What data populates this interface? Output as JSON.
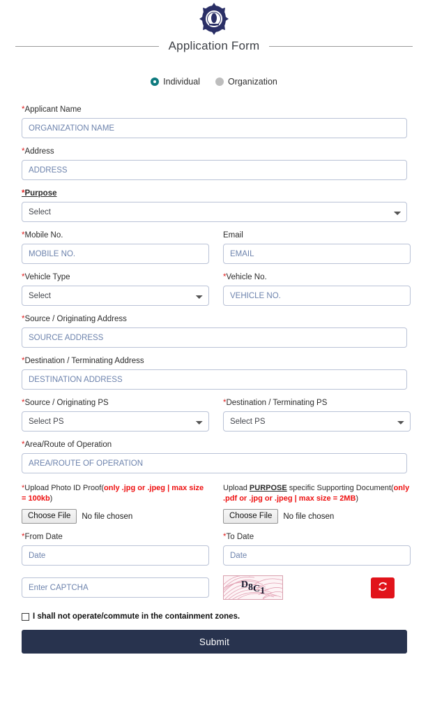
{
  "header": {
    "logo_icon": "police-emblem-icon",
    "title": "Application Form"
  },
  "applicant_type": {
    "options": [
      {
        "label": "Individual",
        "selected": true
      },
      {
        "label": "Organization",
        "selected": false
      }
    ]
  },
  "fields": {
    "applicant_name": {
      "label": "Applicant Name",
      "required": "*",
      "placeholder": "ORGANIZATION NAME",
      "value": ""
    },
    "address": {
      "label": "Address",
      "required": "*",
      "placeholder": "ADDRESS",
      "value": ""
    },
    "purpose": {
      "label": "Purpose",
      "required": "*",
      "selected": "Select"
    },
    "mobile": {
      "label": "Mobile No.",
      "required": "*",
      "placeholder": "MOBILE NO.",
      "value": ""
    },
    "email": {
      "label": "Email",
      "required": "",
      "placeholder": "EMAIL",
      "value": ""
    },
    "vehicle_type": {
      "label": "Vehicle Type",
      "required": "*",
      "selected": "Select"
    },
    "vehicle_no": {
      "label": "Vehicle No.",
      "required": "*",
      "placeholder": "VEHICLE NO.",
      "value": ""
    },
    "source_address": {
      "label": "Source / Originating Address",
      "required": "*",
      "placeholder": "SOURCE ADDRESS",
      "value": ""
    },
    "destination_address": {
      "label": "Destination / Terminating Address",
      "required": "*",
      "placeholder": "DESTINATION ADDRESS",
      "value": ""
    },
    "source_ps": {
      "label": "Source / Originating PS",
      "required": "*",
      "selected": "Select PS"
    },
    "destination_ps": {
      "label": "Destination / Terminating PS",
      "required": "*",
      "selected": "Select PS"
    },
    "area_route": {
      "label": "Area/Route of Operation",
      "required": "*",
      "placeholder": "AREA/ROUTE OF OPERATION",
      "value": ""
    },
    "from_date": {
      "label": "From Date",
      "required": "*",
      "placeholder": "Date",
      "value": ""
    },
    "to_date": {
      "label": "To Date",
      "required": "*",
      "placeholder": "Date",
      "value": ""
    }
  },
  "uploads": {
    "photo_id": {
      "required": "*",
      "label_text": "Upload Photo ID Proof(",
      "warning": "only .jpg or .jpeg | max size = 100kb",
      "label_tail": ")",
      "button_label": "Choose File",
      "status": "No file chosen"
    },
    "supporting_doc": {
      "required": "",
      "label_lead": "Upload ",
      "label_emphasis": "PURPOSE",
      "label_mid": " specific Supporting Document(",
      "warning": "only .pdf or .jpg or .jpeg | max size = 2MB",
      "label_tail": ")",
      "button_label": "Choose File",
      "status": "No file chosen"
    }
  },
  "captcha": {
    "placeholder": "Enter CAPTCHA",
    "value": "",
    "image_text": "D8C1",
    "chars": [
      "D",
      "8",
      "C",
      "1"
    ],
    "refresh_icon": "refresh-icon"
  },
  "consent": {
    "checked": false,
    "text": "I shall not operate/commute in the containment zones."
  },
  "submit": {
    "label": "Submit"
  },
  "colors": {
    "accent_navy": "#28334e",
    "required_red": "#e02020",
    "warning_red": "#ee1111",
    "refresh_red": "#e1141b",
    "radio_selected": "#0f7b7f",
    "input_border": "#b9c2d6",
    "placeholder": "#6d83ad"
  }
}
